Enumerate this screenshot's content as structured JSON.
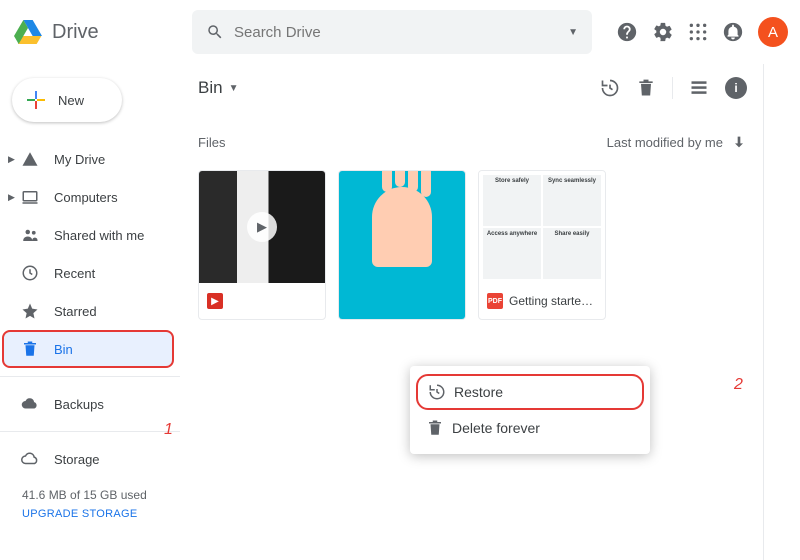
{
  "brand": {
    "name": "Drive"
  },
  "search": {
    "placeholder": "Search Drive"
  },
  "avatar_initial": "A",
  "new_button": "New",
  "sidebar": {
    "items": [
      {
        "label": "My Drive",
        "icon": "drive-triangle-icon",
        "expandable": true
      },
      {
        "label": "Computers",
        "icon": "computer-icon",
        "expandable": true
      },
      {
        "label": "Shared with me",
        "icon": "people-icon",
        "expandable": false
      },
      {
        "label": "Recent",
        "icon": "clock-icon",
        "expandable": false
      },
      {
        "label": "Starred",
        "icon": "star-icon",
        "expandable": false
      },
      {
        "label": "Bin",
        "icon": "trash-icon",
        "expandable": false
      },
      {
        "label": "Backups",
        "icon": "cloud-solid-icon",
        "expandable": false
      },
      {
        "label": "Storage",
        "icon": "cloud-outline-icon",
        "expandable": false
      }
    ]
  },
  "storage": {
    "used_text": "41.6 MB of 15 GB used",
    "upgrade": "UPGRADE STORAGE"
  },
  "breadcrumb": "Bin",
  "section_label": "Files",
  "sort_label": "Last modified by me",
  "files": [
    {
      "name": "",
      "type": "video"
    },
    {
      "name": "",
      "type": "image"
    },
    {
      "name": "Getting starte…",
      "type": "pdf",
      "pdf_label": "PDF"
    }
  ],
  "doc_preview_cells": [
    "Store safely",
    "Sync seamlessly",
    "Access anywhere",
    "Share easily"
  ],
  "context_menu": {
    "restore": "Restore",
    "delete": "Delete forever"
  },
  "annotations": {
    "one": "1",
    "two": "2"
  }
}
